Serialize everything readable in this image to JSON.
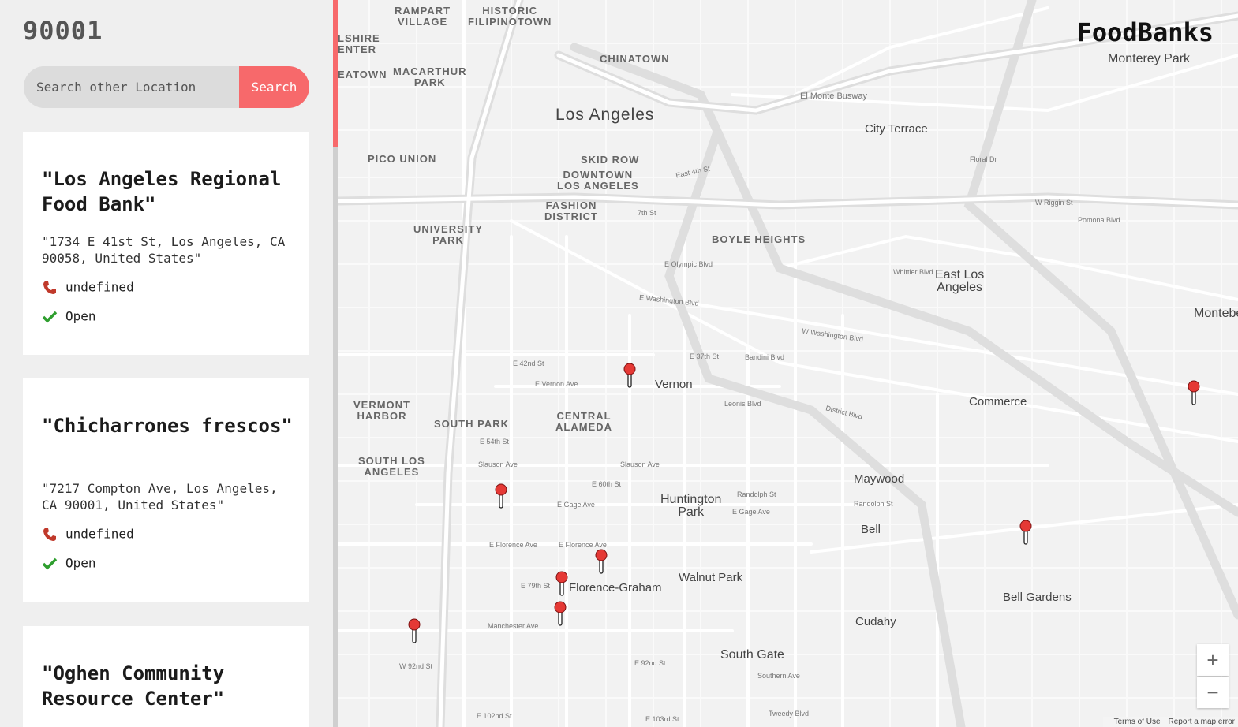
{
  "app": {
    "brand": "FoodBanks"
  },
  "sidebar": {
    "location": "90001",
    "search": {
      "placeholder": "Search other Location",
      "button_label": "Search"
    },
    "results": [
      {
        "name": "\"Los Angeles Regional Food Bank\"",
        "address": "\"1734 E 41st St, Los Angeles, CA 90058, United States\"",
        "phone": "undefined",
        "status": "Open"
      },
      {
        "name": "\"Chicharrones frescos\"",
        "address": "\"7217 Compton Ave, Los Angeles, CA 90001, United States\"",
        "phone": "undefined",
        "status": "Open"
      },
      {
        "name": "\"Oghen Community Resource Center\""
      }
    ]
  },
  "map": {
    "zoom_in": "+",
    "zoom_out": "−",
    "attribution": {
      "terms": "Terms of Use",
      "report": "Report a map error"
    },
    "labels": {
      "los_angeles": "Los Angeles",
      "chinatown": "CHINATOWN",
      "rampart": "RAMPART\nVILLAGE",
      "historic": "HISTORIC\nFILIPINOTOWN",
      "macarthur": "MACARTHUR\nPARK",
      "pico_union": "PICO UNION",
      "skid_row": "SKID ROW",
      "downtown": "DOWNTOWN\nLOS ANGELES",
      "fashion": "FASHION\nDISTRICT",
      "university_park": "UNIVERSITY\nPARK",
      "boyle": "BOYLE HEIGHTS",
      "city_terrace": "City Terrace",
      "east_la": "East Los\nAngeles",
      "monterey_park": "Monterey Park",
      "montebello": "Montebello",
      "vernon": "Vernon",
      "commerce": "Commerce",
      "vermont_harbor": "VERMONT\nHARBOR",
      "south_park": "SOUTH PARK",
      "central_alameda": "CENTRAL\nALAMEDA",
      "south_la": "SOUTH LOS\nANGELES",
      "huntington": "Huntington\nPark",
      "maywood": "Maywood",
      "bell": "Bell",
      "walnut_park": "Walnut Park",
      "florence_graham": "Florence-Graham",
      "bell_gardens": "Bell Gardens",
      "cudahy": "Cudahy",
      "south_gate": "South Gate",
      "shire_center": "LSHIRE\nENTER",
      "eatown": "EATOWN"
    },
    "streets": {
      "el_monte": "El Monte Busway",
      "e4th": "East 4th St",
      "e7th": "7th St",
      "olympic": "E Olympic Blvd",
      "washington": "E Washington Blvd",
      "e37": "E 37th St",
      "bandini": "Bandini Blvd",
      "vernon_ave": "E Vernon Ave",
      "e42": "E 42nd St",
      "slauson": "Slauson Ave",
      "e60": "E 60th St",
      "gage": "E Gage Ave",
      "florence": "E Florence Ave",
      "e79": "E 79th St",
      "manchester": "Manchester Ave",
      "e92": "E 92nd St",
      "e103": "E 103rd St",
      "e102": "E 102nd St",
      "randolph": "Randolph St",
      "w_wash": "W Washington Blvd",
      "floral": "Floral Dr",
      "whittier": "Whittier Blvd",
      "pomona": "Pomona Blvd",
      "leonis": "Leonis Blvd",
      "district": "District Blvd",
      "tweedy": "Tweedy Blvd",
      "southern": "Southern Ave",
      "w92": "W 92nd St",
      "e54": "E 54th St",
      "riggin": "W Riggin St"
    }
  }
}
